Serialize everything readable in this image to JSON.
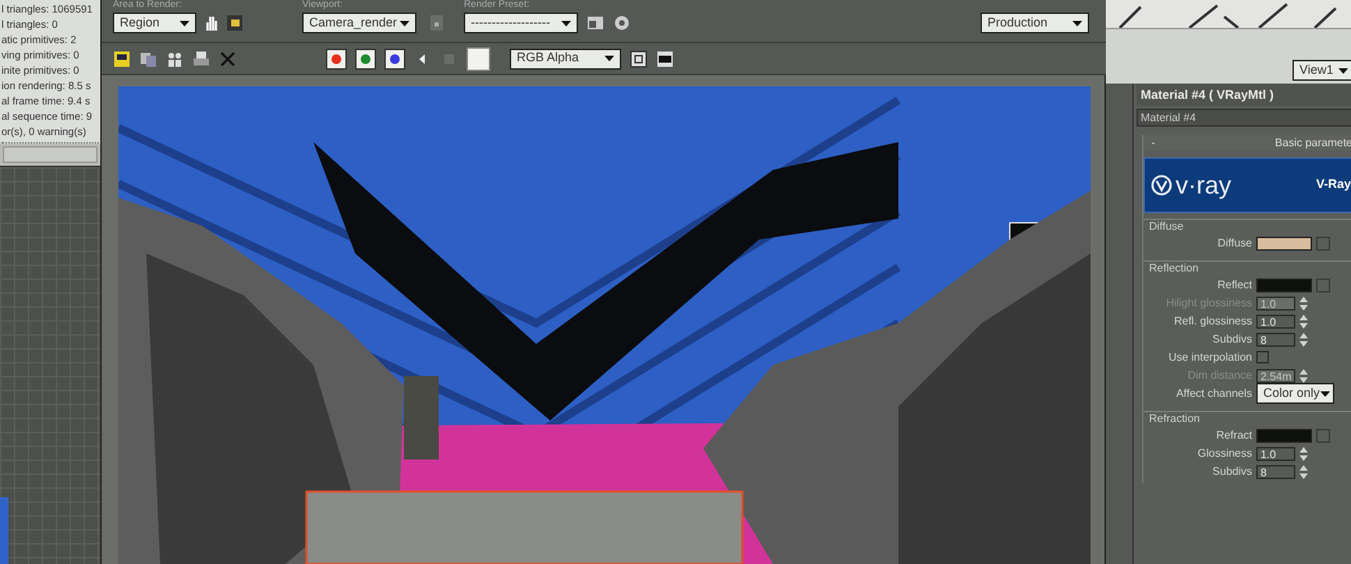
{
  "log_panel": {
    "lines": [
      "l triangles: 1069591",
      "l triangles: 0",
      "atic primitives: 2",
      "ving primitives: 0",
      "inite primitives: 0",
      "ion rendering: 8.5 s",
      "al frame time: 9.4 s",
      "al sequence time: 9",
      "or(s), 0 warning(s)"
    ]
  },
  "render_window": {
    "area_to_render": {
      "label": "Area to Render:",
      "value": "Region"
    },
    "viewport": {
      "label": "Viewport:",
      "value": "Camera_render"
    },
    "render_preset": {
      "label": "Render Preset:",
      "value": "-------------------"
    },
    "preset_mode": {
      "value": "Production"
    },
    "channels": [
      {
        "color": "#e8301c",
        "on": true
      },
      {
        "color": "#1f8a2e",
        "on": true
      },
      {
        "color": "#3a3ae0",
        "on": true
      }
    ],
    "display_channel": {
      "value": "RGB Alpha"
    }
  },
  "material_editor": {
    "view_dropdown": {
      "value": "View1"
    },
    "title": "Material #4  ( VRayMtl )",
    "name_field": {
      "value": "Material #4"
    },
    "rollout": {
      "expanded": true,
      "toggle": "-",
      "title": "Basic paramete"
    },
    "banner": {
      "logo": "v·ray",
      "title": "V-Ray"
    },
    "groups": [
      {
        "title": "Diffuse",
        "params": [
          {
            "kind": "color",
            "label": "Diffuse",
            "color": "#d9bb9d"
          }
        ]
      },
      {
        "title": "Reflection",
        "params": [
          {
            "kind": "color",
            "label": "Reflect",
            "color": "#0e100d"
          },
          {
            "kind": "spinner",
            "label": "Hilight glossiness",
            "value": "1.0",
            "disabled": true
          },
          {
            "kind": "spinner",
            "label": "Refl. glossiness",
            "value": "1.0",
            "disabled": false
          },
          {
            "kind": "spinner",
            "label": "Subdivs",
            "value": "8",
            "disabled": false
          },
          {
            "kind": "checkbox",
            "label": "Use interpolation",
            "checked": false
          },
          {
            "kind": "spinner",
            "label": "Dim distance",
            "value": "2.54m",
            "disabled": true
          },
          {
            "kind": "dropdown",
            "label": "Affect channels",
            "value": "Color only"
          }
        ]
      },
      {
        "title": "Refraction",
        "params": [
          {
            "kind": "color",
            "label": "Refract",
            "color": "#0e100d"
          },
          {
            "kind": "spinner",
            "label": "Glossiness",
            "value": "1.0",
            "disabled": false
          },
          {
            "kind": "spinner",
            "label": "Subdivs",
            "value": "8",
            "disabled": false
          }
        ]
      }
    ]
  }
}
